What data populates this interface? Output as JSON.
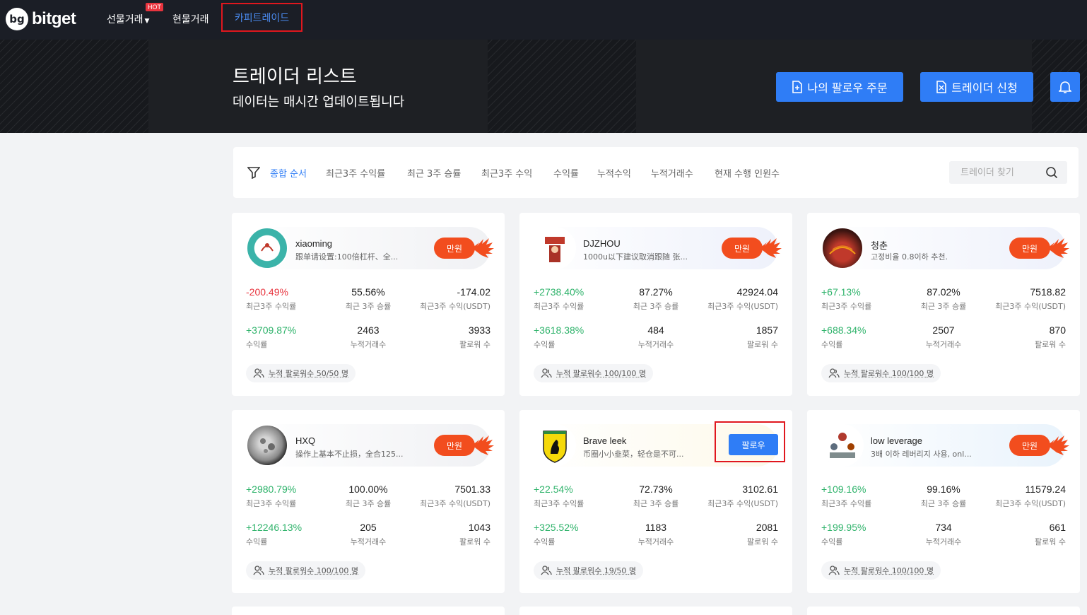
{
  "nav": {
    "brand": "bitget",
    "logo_mark": "bg",
    "futures": "선물거래",
    "hot": "HOT",
    "spot": "현물거래",
    "copy_trade": "카피트레이드"
  },
  "banner": {
    "title": "트레이더 리스트",
    "subtitle": "데이터는 매시간 업데이트됩니다",
    "my_follow_orders": "나의 팔로우 주문",
    "apply_trader": "트레이더 신청"
  },
  "filter": {
    "sorts": [
      "종합 순서",
      "최근3주 수익률",
      "최근 3주 승률",
      "최근3주 수익",
      "수익률",
      "누적수익",
      "누적거래수",
      "현재 수행 인원수"
    ],
    "search_placeholder": "트레이더 찾기"
  },
  "labels": {
    "roi_3w": "최근3주 수익률",
    "winrate_3w": "최근 3주 승률",
    "profit_3w": "최근3주 수익(USDT)",
    "roi": "수익률",
    "trades": "누적거래수",
    "followers": "팔로워 수",
    "full": "만원",
    "follow": "팔로우",
    "quota_prefix": "누적 팔로워수",
    "quota_suffix": "명"
  },
  "traders": [
    {
      "name": "xiaoming",
      "desc": "跟单请设置:100倍杠杆、全...",
      "roi_3w": "-200.49%",
      "winrate_3w": "55.56%",
      "profit_3w": "-174.02",
      "roi": "+3709.87%",
      "trades": "2463",
      "followers": "3933",
      "quota": "50/50",
      "status": "full"
    },
    {
      "name": "DJZHOU",
      "desc": "1000u以下建议取消跟随 张...",
      "roi_3w": "+2738.40%",
      "winrate_3w": "87.27%",
      "profit_3w": "42924.04",
      "roi": "+3618.38%",
      "trades": "484",
      "followers": "1857",
      "quota": "100/100",
      "status": "full"
    },
    {
      "name": "청춘",
      "desc": "고정비율 0.8이하 추천.",
      "roi_3w": "+67.13%",
      "winrate_3w": "87.02%",
      "profit_3w": "7518.82",
      "roi": "+688.34%",
      "trades": "2507",
      "followers": "870",
      "quota": "100/100",
      "status": "full"
    },
    {
      "name": "HXQ",
      "desc": "操作上基本不止损，全合125...",
      "roi_3w": "+2980.79%",
      "winrate_3w": "100.00%",
      "profit_3w": "7501.33",
      "roi": "+12246.13%",
      "trades": "205",
      "followers": "1043",
      "quota": "100/100",
      "status": "full"
    },
    {
      "name": "Brave leek",
      "desc": "币圈小小韭菜，轻仓是不可...",
      "roi_3w": "+22.54%",
      "winrate_3w": "72.73%",
      "profit_3w": "3102.61",
      "roi": "+325.52%",
      "trades": "1183",
      "followers": "2081",
      "quota": "19/50",
      "status": "open"
    },
    {
      "name": "low leverage",
      "desc": "3배 이하 레버리지 사용, onl...",
      "roi_3w": "+109.16%",
      "winrate_3w": "99.16%",
      "profit_3w": "11579.24",
      "roi": "+199.95%",
      "trades": "734",
      "followers": "661",
      "quota": "100/100",
      "status": "full"
    }
  ],
  "colors": {
    "accent": "#2f7df6",
    "positive": "#2fb36b",
    "negative": "#e8343e",
    "full_badge": "#f24d1e",
    "highlight": "#e0171e"
  },
  "icons": [
    "filter-icon",
    "search-icon",
    "document-icon",
    "apply-icon",
    "bell-icon",
    "users-icon",
    "flame-icon"
  ]
}
